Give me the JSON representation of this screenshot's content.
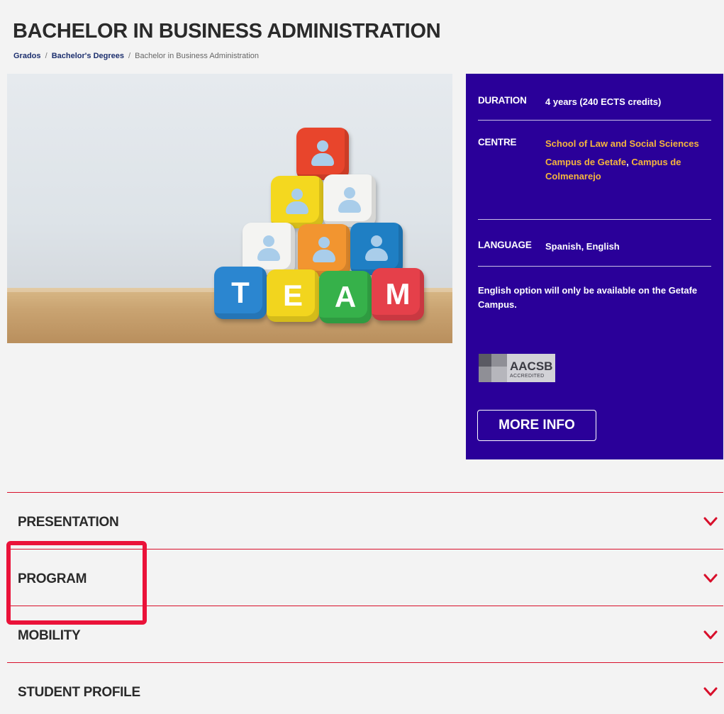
{
  "page": {
    "title": "BACHELOR IN BUSINESS ADMINISTRATION",
    "breadcrumb": {
      "items": [
        "Grados",
        "Bachelor's Degrees"
      ],
      "separator": "/",
      "current": "Bachelor in Business Administration"
    }
  },
  "hero": {
    "letters": [
      "T",
      "E",
      "A",
      "M"
    ],
    "colors": {
      "sky": "#e6eaee",
      "table": "#c9a371"
    }
  },
  "info": {
    "background": "#2a0099",
    "duration": {
      "label": "DURATION",
      "value": "4 years (240 ECTS credits)"
    },
    "centre": {
      "label": "CENTRE",
      "school": "School of Law and Social Sciences",
      "campus_getafe": "Campus de Getafe",
      "separator": ",",
      "campus_colmenarejo": "Campus de Colmenarejo"
    },
    "language": {
      "label": "LANGUAGE",
      "value": "Spanish, English"
    },
    "note": "English option will only be available on the Getafe Campus.",
    "accreditation": {
      "name": "AACSB",
      "sub": "ACCREDITED"
    },
    "more_info_label": "MORE INFO",
    "link_color": "#f5b53d"
  },
  "accordion": {
    "accent_color": "#d80f2b",
    "items": [
      {
        "label": "PRESENTATION"
      },
      {
        "label": "PROGRAM"
      },
      {
        "label": "MOBILITY"
      },
      {
        "label": "STUDENT PROFILE"
      }
    ]
  }
}
